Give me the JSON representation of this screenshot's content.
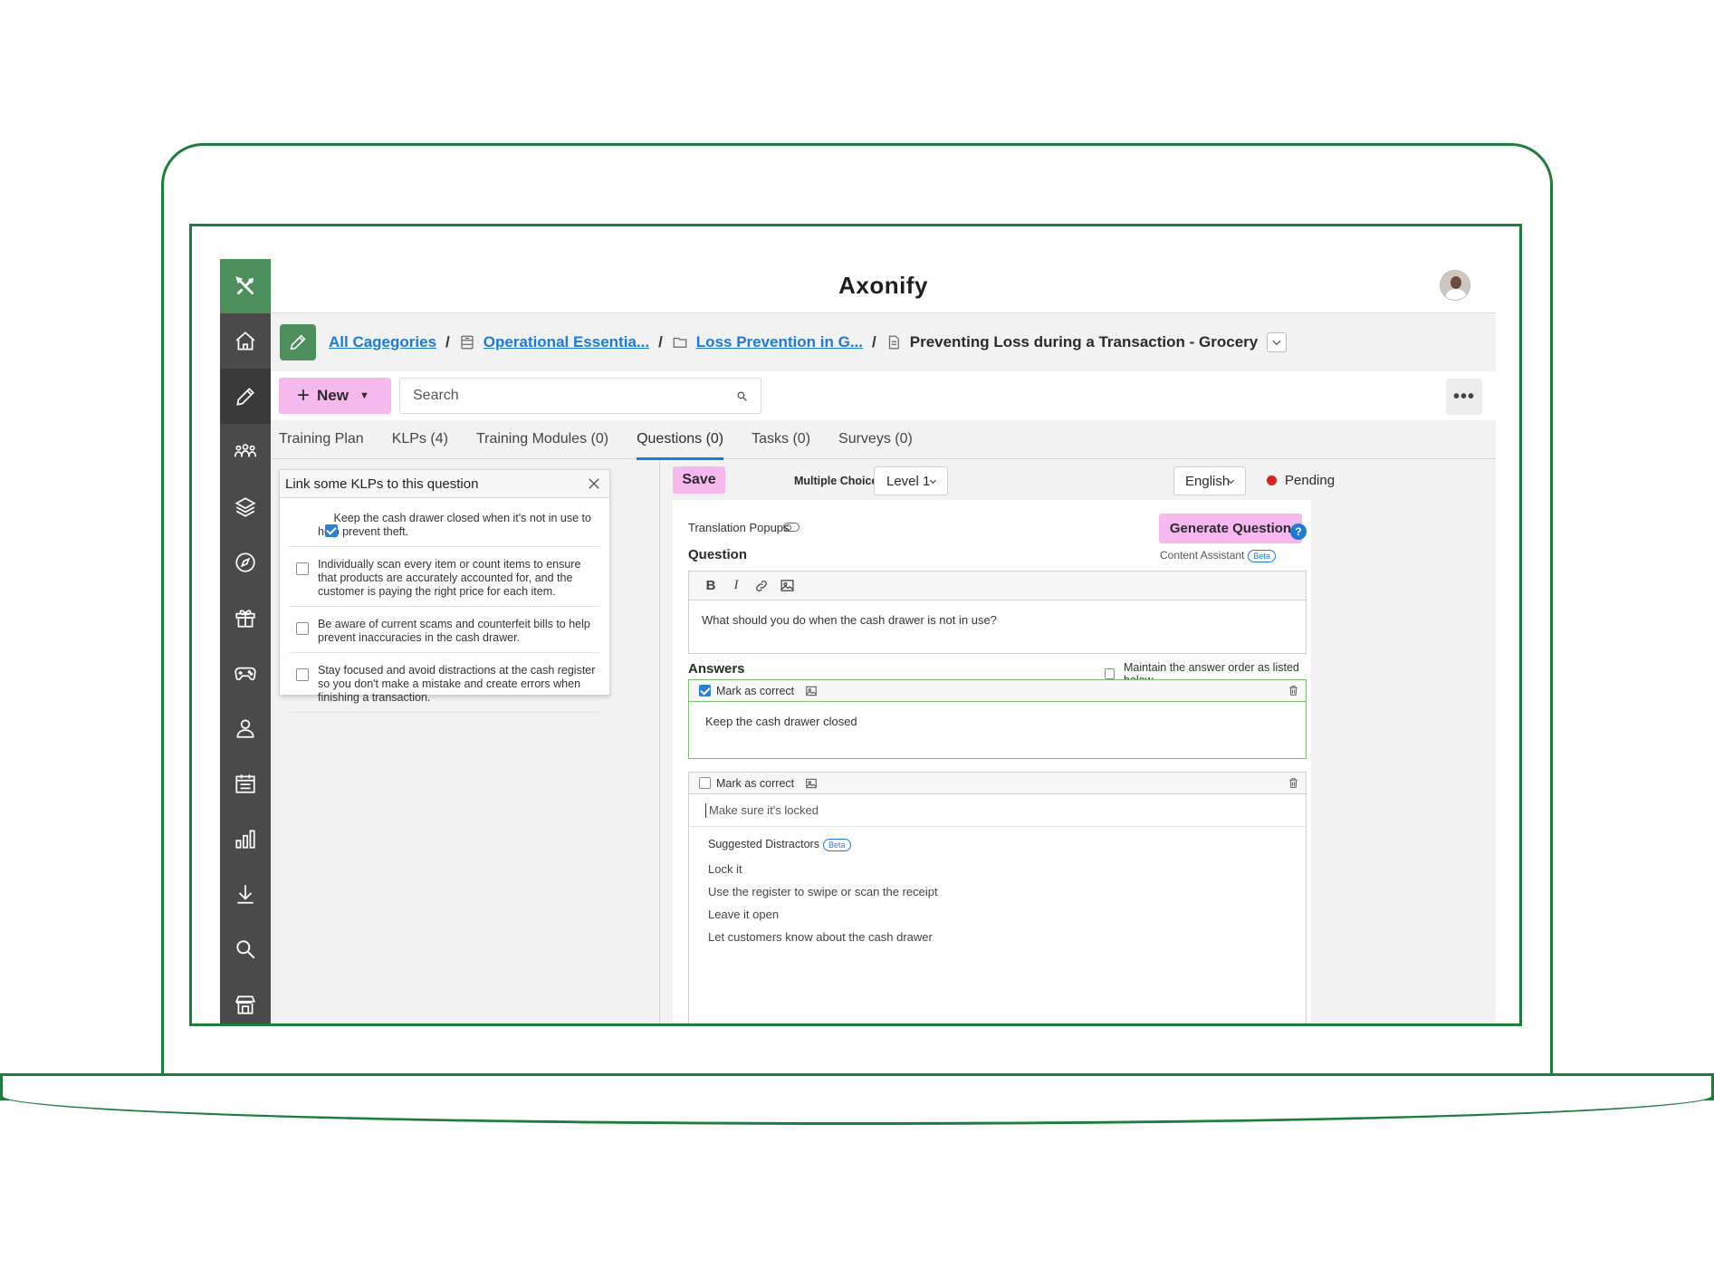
{
  "app": {
    "brand": "Axonify"
  },
  "sidebar": {
    "items": [
      {
        "name": "home-icon",
        "active": false
      },
      {
        "name": "pencil-icon",
        "active": true
      },
      {
        "name": "people-icon",
        "active": false
      },
      {
        "name": "layers-icon",
        "active": false
      },
      {
        "name": "compass-icon",
        "active": false
      },
      {
        "name": "gift-icon",
        "active": false
      },
      {
        "name": "gamepad-icon",
        "active": false
      },
      {
        "name": "user-icon",
        "active": false
      },
      {
        "name": "calendar-icon",
        "active": false
      },
      {
        "name": "bar-chart-icon",
        "active": false
      },
      {
        "name": "download-icon",
        "active": false
      },
      {
        "name": "search-icon",
        "active": false
      },
      {
        "name": "store-icon",
        "active": false
      }
    ]
  },
  "breadcrumb": {
    "items": [
      {
        "label": "All Cagegories"
      },
      {
        "label": "Operational Essentia..."
      },
      {
        "label": "Loss Prevention in G..."
      }
    ],
    "current": "Preventing Loss during a Transaction - Grocery",
    "separator": "/"
  },
  "toolbar": {
    "new_label": "New",
    "search_placeholder": "Search",
    "more_label": "•••"
  },
  "tabs": [
    {
      "label": "Training Plan",
      "active": false
    },
    {
      "label": "KLPs (4)",
      "active": false
    },
    {
      "label": "Training Modules (0)",
      "active": false
    },
    {
      "label": "Questions (0)",
      "active": true
    },
    {
      "label": "Tasks (0)",
      "active": false
    },
    {
      "label": "Surveys (0)",
      "active": false
    }
  ],
  "klp_panel": {
    "title": "Link some KLPs to this question",
    "items": [
      {
        "text": "Keep the cash drawer closed when it's not in use to help prevent theft.",
        "checked": true
      },
      {
        "text": "Individually scan every item or count items to ensure that products are accurately accounted for, and the customer is paying the right price for each item.",
        "checked": false
      },
      {
        "text": "Be aware of current scams and counterfeit bills to help prevent inaccuracies in the cash drawer.",
        "checked": false
      },
      {
        "text": "Stay focused and avoid distractions at the cash register so you don't make a mistake and create errors when finishing a transaction.",
        "checked": false
      }
    ]
  },
  "editor": {
    "save_label": "Save",
    "question_type_label": "Multiple Choice -",
    "level_value": "Level 1",
    "language_value": "English",
    "status_label": "Pending",
    "status_color": "#e01c1c",
    "translation_popups_label": "Translation Popups",
    "generate_label": "Generate Question",
    "help_label": "?",
    "content_assistant_label": "Content Assistant",
    "beta_label": "Beta",
    "question_label": "Question",
    "rte_buttons": {
      "bold": "B",
      "italic": "I"
    },
    "question_text": "What should you do when the cash drawer is not in use?",
    "answers_label": "Answers",
    "maintain_order_label": "Maintain the answer order as listed below",
    "mark_correct_label": "Mark as correct",
    "answers": [
      {
        "text": "Keep the cash drawer closed",
        "correct": true
      },
      {
        "text": "Make sure it's locked",
        "correct": false
      }
    ],
    "suggested_distractors_label": "Suggested Distractors",
    "distractors": [
      "Lock it",
      "Use the register to swipe or scan the receipt",
      "Leave it open",
      "Let customers know about the cash drawer"
    ]
  },
  "colors": {
    "accent_green": "#4c8f5b",
    "frame_green": "#1e7d3a",
    "pink_button": "#f5b9ee",
    "link_blue": "#1f7ad6",
    "sidebar_bg": "#4a4a4a"
  }
}
